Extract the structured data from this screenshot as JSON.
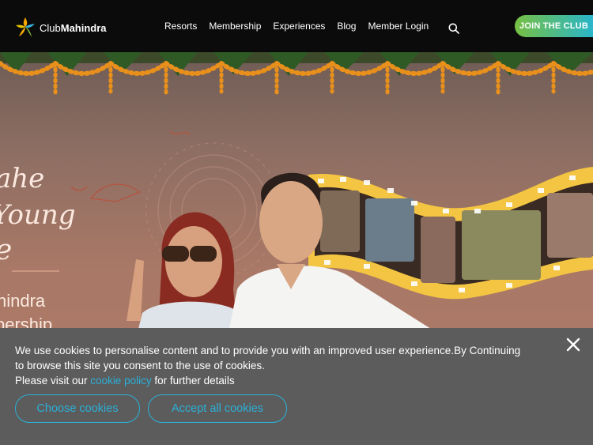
{
  "header": {
    "logo_text_light": "Club",
    "logo_text_bold": "Mahindra",
    "nav": [
      "Resorts",
      "Membership",
      "Experiences",
      "Blog",
      "Member Login"
    ],
    "join_label": "JOIN THE CLUB"
  },
  "hero": {
    "lines": [
      "ahe",
      "Young",
      "e",
      "hindra",
      "bership"
    ]
  },
  "cookie_banner": {
    "text_part1": "We use cookies to personalise content and to provide you with an improved user experience.By Continuing to browse this site you consent to the use of cookies.",
    "text_part2": "Please visit our ",
    "link_text": "cookie policy",
    "text_part3": " for further details",
    "choose_label": "Choose cookies",
    "accept_label": "Accept all cookies"
  },
  "colors": {
    "accent": "#2bb0d8",
    "join_gradient_start": "#77c043",
    "join_gradient_end": "#29b6c9",
    "banner_bg": "#5c5c5c",
    "header_bg": "#0b0b0b"
  },
  "icons": [
    "clubmahindra-logo-icon",
    "search-icon",
    "close-icon"
  ]
}
